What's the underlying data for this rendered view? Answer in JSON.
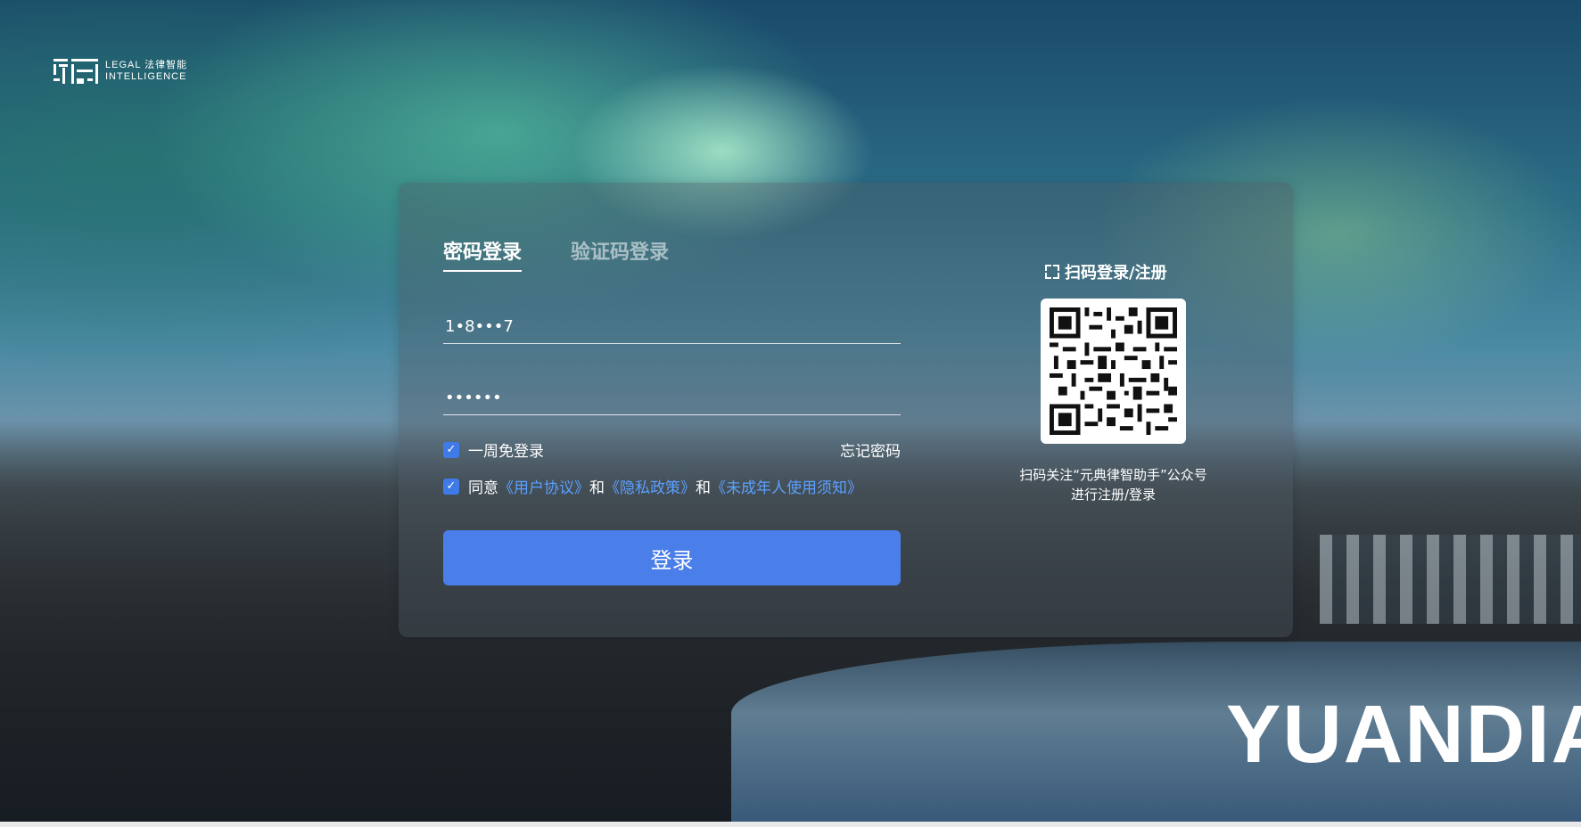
{
  "logo": {
    "line1": "LEGAL 法律智能",
    "line2": "INTELLIGENCE"
  },
  "tabs": [
    {
      "label": "密码登录",
      "active": true
    },
    {
      "label": "验证码登录",
      "active": false
    }
  ],
  "form": {
    "username_value": "1•8•••7",
    "password_value": "••••••",
    "remember_label": "一周免登录",
    "remember_checked": true,
    "forgot_label": "忘记密码",
    "agree_checked": true,
    "agree_prefix": "同意",
    "agree_link1": "《用户协议》",
    "agree_and1": "和",
    "agree_link2": "《隐私政策》",
    "agree_and2": "和",
    "agree_link3": "《未成年人使用须知》",
    "login_label": "登录"
  },
  "qr": {
    "title": "扫码登录/注册",
    "caption_line1": "扫码关注“元典律智助手”公众号",
    "caption_line2": "进行注册/登录"
  },
  "brand_text": "YUANDIAN",
  "colors": {
    "accent": "#4a7ee8",
    "link": "#5aa0ff",
    "checkbox": "#3f7be8"
  }
}
